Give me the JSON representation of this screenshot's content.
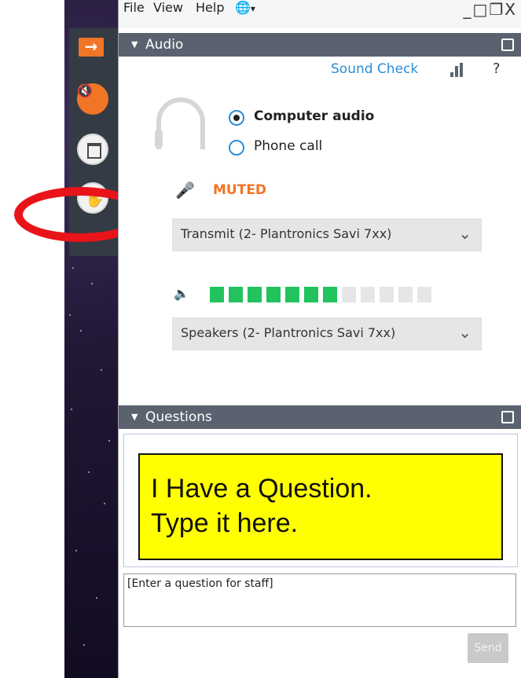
{
  "menu": {
    "file": "File",
    "view": "View",
    "help": "Help",
    "language_icon": "globe-icon"
  },
  "window_controls": "_□❐X",
  "audio": {
    "title": "Audio",
    "sound_check": "Sound Check",
    "help": "?",
    "computer_audio": "Computer audio",
    "phone_call": "Phone call",
    "muted": "MUTED",
    "transmit_device": "Transmit (2- Plantronics Savi 7xx)",
    "speaker_device": "Speakers (2- Plantronics Savi 7xx)",
    "speaker_level_fraction": 0.58
  },
  "questions": {
    "title": "Questions",
    "callout_line1": "I Have a Question.",
    "callout_line2": "Type it here.",
    "input_placeholder": "[Enter a question for staff]",
    "send": "Send"
  },
  "colors": {
    "accent_orange": "#f07526",
    "link_blue": "#2a8ed6",
    "level_on": "#22c35e",
    "level_off": "#e6e6e6",
    "annotation_red": "#e8141a",
    "callout_yellow": "#ffff00"
  }
}
